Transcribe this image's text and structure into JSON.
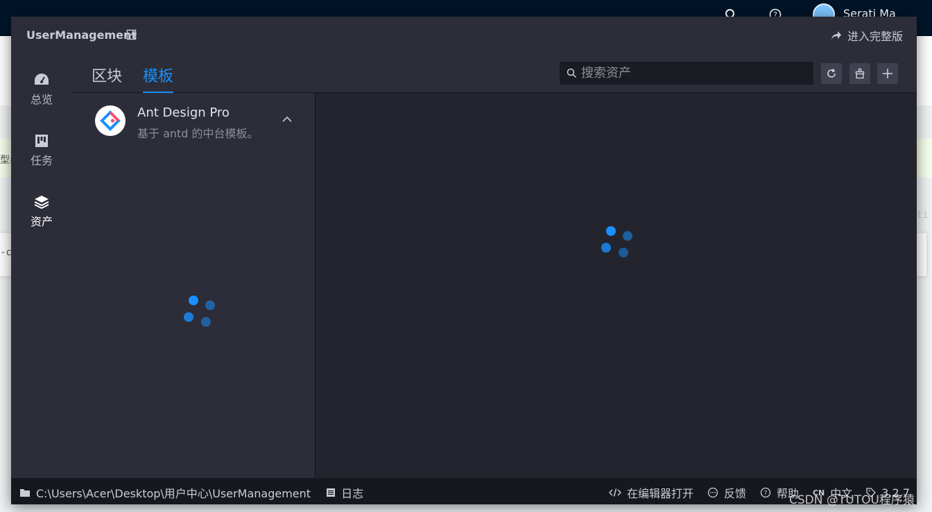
{
  "background": {
    "user_name": "Serati Ma",
    "fragment_left_1": "型纟",
    "fragment_left_2": "-c",
    "fragment_right": "ti"
  },
  "header": {
    "project_name": "UserManagement",
    "full_version_label": "进入完整版"
  },
  "side_nav": {
    "items": [
      {
        "label": "总览"
      },
      {
        "label": "任务"
      },
      {
        "label": "资产"
      }
    ],
    "active": "资产"
  },
  "tabs": [
    {
      "label": "区块"
    },
    {
      "label": "模板"
    }
  ],
  "active_tab": "模板",
  "search": {
    "placeholder": "搜索资产",
    "value": ""
  },
  "template_list": [
    {
      "title": "Ant Design Pro",
      "description": "基于 antd 的中台模板。"
    }
  ],
  "status_bar": {
    "path": "C:\\Users\\Acer\\Desktop\\用户中心\\UserManagement",
    "log_label": "日志",
    "open_in_editor_label": "在编辑器打开",
    "feedback_label": "反馈",
    "help_label": "帮助",
    "lang_code": "CN",
    "lang_label": "中文",
    "version": "3.2.7"
  },
  "watermark": "CSDN @TUTOU程序猿",
  "colors": {
    "accent": "#1890ff",
    "panel_bg": "#2c2d38",
    "dark_bg": "#23242d"
  }
}
